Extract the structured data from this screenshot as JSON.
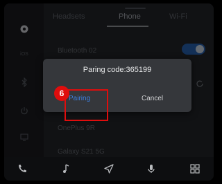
{
  "tabs": {
    "headsets": "Headsets",
    "phone": "Phone",
    "wifi": "Wi-Fi"
  },
  "rail": {
    "items": [
      {
        "icon": "settings-icon",
        "active": true
      },
      {
        "icon": "ios-icon",
        "label": "iOS"
      },
      {
        "icon": "bluetooth-icon"
      },
      {
        "icon": "power-icon"
      },
      {
        "icon": "display-icon"
      }
    ]
  },
  "devices": {
    "connected": "Bluetooth 02",
    "list": [
      "OnePlus 9R",
      "Galaxy S21 5G"
    ]
  },
  "toggle": {
    "state": "on"
  },
  "dialog": {
    "title": "Paring code:365199",
    "pairing_label": "Pairing",
    "cancel_label": "Cancel"
  },
  "annotation": {
    "step": "6"
  },
  "bottom_nav": [
    "phone-icon",
    "music-icon",
    "navigation-icon",
    "microphone-icon",
    "apps-grid-icon"
  ],
  "colors": {
    "accent": "#3c7fe0",
    "highlight": "#e00d0d",
    "toggle_on": "#1e4a86"
  }
}
